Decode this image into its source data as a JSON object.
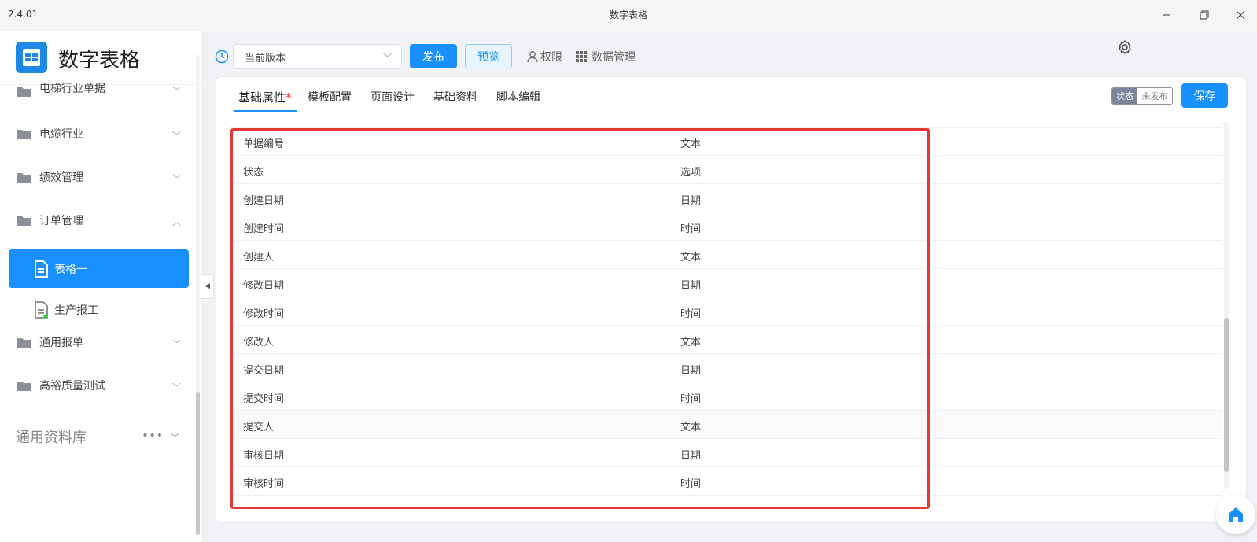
{
  "window": {
    "version": "2.4.01",
    "title": "数字表格"
  },
  "sidebar": {
    "app_name": "数字表格",
    "items": [
      {
        "label": "电梯行业单据"
      },
      {
        "label": "电缆行业"
      },
      {
        "label": "绩效管理"
      },
      {
        "label": "订单管理"
      },
      {
        "label": "通用报单"
      },
      {
        "label": "高裕质量测试"
      }
    ],
    "sub_items": [
      {
        "label": "表格一",
        "active": true
      },
      {
        "label": "生产报工",
        "active": false
      }
    ],
    "library": {
      "label": "通用资料库",
      "more": "•••"
    }
  },
  "toolbar": {
    "version_select": "当前版本",
    "publish": "发布",
    "preview": "预览",
    "permission": "权限",
    "data_manage": "数据管理"
  },
  "tabs": [
    {
      "label": "基础属性",
      "required_mark": "*",
      "active": true
    },
    {
      "label": "模板配置"
    },
    {
      "label": "页面设计"
    },
    {
      "label": "基础资料"
    },
    {
      "label": "脚本编辑"
    }
  ],
  "status": {
    "state_label": "状态",
    "state_value": "未发布"
  },
  "save": "保存",
  "fields": [
    {
      "name": "单据编号",
      "type": "文本"
    },
    {
      "name": "状态",
      "type": "选项"
    },
    {
      "name": "创建日期",
      "type": "日期"
    },
    {
      "name": "创建时间",
      "type": "时间"
    },
    {
      "name": "创建人",
      "type": "文本"
    },
    {
      "name": "修改日期",
      "type": "日期"
    },
    {
      "name": "修改时间",
      "type": "时间"
    },
    {
      "name": "修改人",
      "type": "文本"
    },
    {
      "name": "提交日期",
      "type": "日期"
    },
    {
      "name": "提交时间",
      "type": "时间"
    },
    {
      "name": "提交人",
      "type": "文本"
    },
    {
      "name": "审核日期",
      "type": "日期"
    },
    {
      "name": "审核时间",
      "type": "时间"
    }
  ],
  "colors": {
    "accent": "#1890ff",
    "highlight": "#e53935"
  }
}
